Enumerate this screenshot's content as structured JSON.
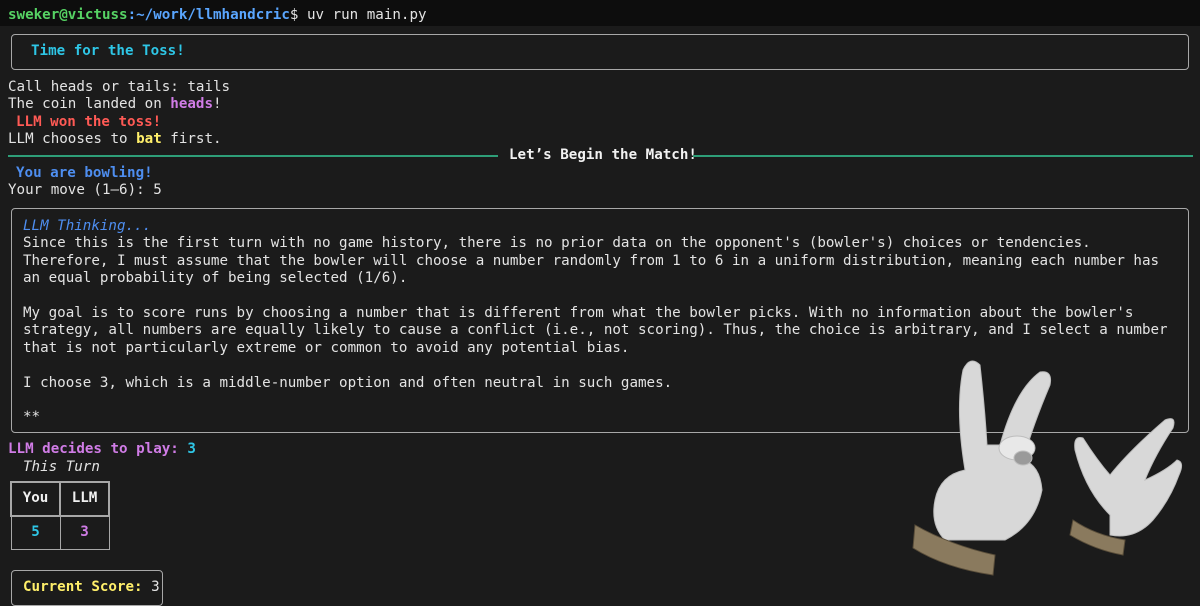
{
  "terminal": {
    "user_host": "sweker@victuss",
    "path": ":~/work/llmhandcric",
    "command": "$ uv run main.py"
  },
  "toss": {
    "banner": "Time for the Toss!",
    "call_prompt": "Call heads or tails: ",
    "call_value": "tails",
    "landed_prefix": "The coin landed on ",
    "landed_value": "heads",
    "landed_suffix": "!",
    "winner": "LLM won the toss!",
    "choice_prefix": "LLM chooses to ",
    "choice_value": "bat",
    "choice_suffix": " first."
  },
  "match": {
    "divider_title": "Let’s Begin the Match!",
    "role": "You are bowling!",
    "move_prompt": "Your move (1–6): ",
    "move_value": "5"
  },
  "thinking": {
    "title": "LLM Thinking...",
    "paragraphs": [
      "Since this is the first turn with no game history, there is no prior data on the opponent's (bowler's) choices or tendencies. Therefore, I must assume that the bowler will choose a number randomly from 1 to 6 in a uniform distribution, meaning each number has an equal probability of being selected (1/6).",
      "My goal is to score runs by choosing a number that is different from what the bowler picks. With no information about the bowler's strategy, all numbers are equally likely to cause a conflict (i.e., not scoring). Thus, the choice is arbitrary, and I select a number that is not particularly extreme or common to avoid any potential bias.",
      "I choose 3, which is a middle-number option and often neutral in such games.",
      "**"
    ]
  },
  "decision": {
    "label": "LLM decides to play: ",
    "value": "3"
  },
  "turn_table": {
    "caption": "This Turn",
    "headers": [
      "You",
      "LLM"
    ],
    "values": [
      "5",
      "3"
    ]
  },
  "score": {
    "label": "Current Score: ",
    "value": "3"
  },
  "colors": {
    "background": "#1b1b1b",
    "cyan": "#2ec6e6",
    "magenta": "#d07ce6",
    "red": "#ff5a55",
    "yellow": "#ffef6a",
    "blue": "#4e8ef0",
    "green": "#56d364",
    "divider": "#2e9e78"
  },
  "overlay": {
    "icon": "rock-hand-gestures-icon"
  }
}
